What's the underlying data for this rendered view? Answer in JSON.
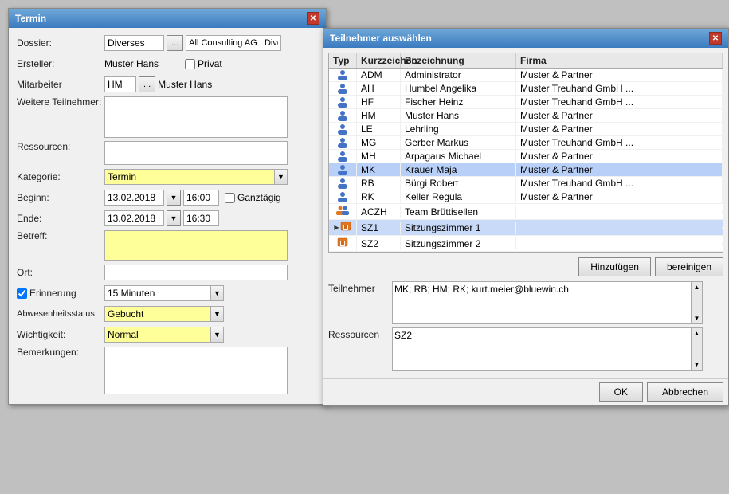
{
  "main_window": {
    "title": "Termin",
    "close_label": "✕",
    "fields": {
      "dossier_label": "Dossier:",
      "dossier_value": "Diverses",
      "dossier_btn": "...",
      "dossier_right": "All Consulting AG : Divers",
      "ersteller_label": "Ersteller:",
      "ersteller_value": "Muster Hans",
      "privat_label": "Privat",
      "mitarbeiter_label": "Mitarbeiter",
      "mitarbeiter_value": "HM",
      "mitarbeiter_btn": "...",
      "mitarbeiter_right": "Muster Hans",
      "weitere_label": "Weitere Teilnehmer:",
      "ressourcen_label": "Ressourcen:",
      "kategorie_label": "Kategorie:",
      "kategorie_value": "Termin",
      "beginn_label": "Beginn:",
      "beginn_date": "13.02.2018",
      "beginn_time": "16:00",
      "ganztaegig_label": "Ganztägig",
      "ende_label": "Ende:",
      "ende_date": "13.02.2018",
      "ende_time": "16:30",
      "betreff_label": "Betreff:",
      "ort_label": "Ort:",
      "erinnerung_label": "Erinnerung",
      "erinnerung_value": "15 Minuten",
      "abwesenheit_label": "Abwesenheitsstatus:",
      "abwesenheit_value": "Gebucht",
      "wichtigkeit_label": "Wichtigkeit:",
      "wichtigkeit_value": "Normal",
      "bemerkungen_label": "Bemerkungen:"
    }
  },
  "dialog": {
    "title": "Teilnehmer auswählen",
    "close_label": "✕",
    "columns": {
      "typ": "Typ",
      "kz": "Kurzzeichen",
      "bez": "Bezeichnung",
      "firma": "Firma"
    },
    "rows": [
      {
        "typ": "person",
        "kz": "ADM",
        "bez": "Administrator",
        "firma": "Muster & Partner",
        "selected": false
      },
      {
        "typ": "person",
        "kz": "AH",
        "bez": "Humbel Angelika",
        "firma": "Muster Treuhand GmbH ...",
        "selected": false
      },
      {
        "typ": "person",
        "kz": "HF",
        "bez": "Fischer Heinz",
        "firma": "Muster Treuhand GmbH ...",
        "selected": false
      },
      {
        "typ": "person",
        "kz": "HM",
        "bez": "Muster Hans",
        "firma": "Muster & Partner",
        "selected": false
      },
      {
        "typ": "person",
        "kz": "LE",
        "bez": "Lehrling",
        "firma": "Muster & Partner",
        "selected": false
      },
      {
        "typ": "person",
        "kz": "MG",
        "bez": "Gerber Markus",
        "firma": "Muster Treuhand GmbH ...",
        "selected": false
      },
      {
        "typ": "person",
        "kz": "MH",
        "bez": "Arpagaus Michael",
        "firma": "Muster & Partner",
        "selected": false
      },
      {
        "typ": "person",
        "kz": "MK",
        "bez": "Krauer Maja",
        "firma": "Muster & Partner",
        "selected": true
      },
      {
        "typ": "person",
        "kz": "RB",
        "bez": "Bürgi Robert",
        "firma": "Muster Treuhand GmbH ...",
        "selected": false
      },
      {
        "typ": "person",
        "kz": "RK",
        "bez": "Keller Regula",
        "firma": "Muster & Partner",
        "selected": false
      },
      {
        "typ": "group",
        "kz": "ACZH",
        "bez": "Team Brüttisellen",
        "firma": "",
        "selected": false
      },
      {
        "typ": "room",
        "kz": "SZ1",
        "bez": "Sitzungszimmer 1",
        "firma": "",
        "selected": false
      },
      {
        "typ": "room",
        "kz": "SZ2",
        "bez": "Sitzungszimmer 2",
        "firma": "",
        "selected": false
      }
    ],
    "hinzufuegen_btn": "Hinzufügen",
    "bereinigen_btn": "bereinigen",
    "teilnehmer_label": "Teilnehmer",
    "teilnehmer_value": "MK; RB; HM; RK; kurt.meier@bluewin.ch",
    "ressourcen_label": "Ressourcen",
    "ressourcen_value": "SZ2",
    "ok_btn": "OK",
    "abbrechen_btn": "Abbrechen",
    "selected_row_index": 11
  }
}
